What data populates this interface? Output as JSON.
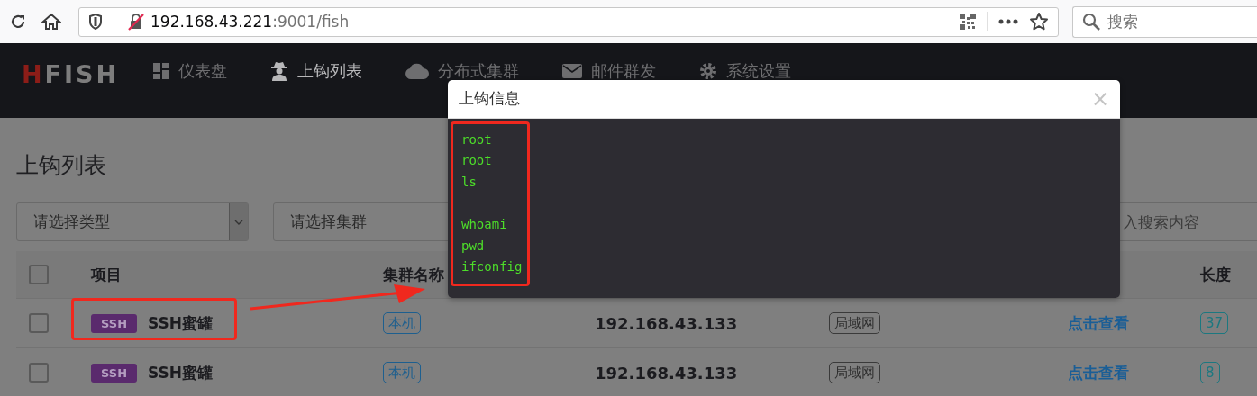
{
  "browser": {
    "url_host": "192.168.43.221",
    "url_rest": ":9001/fish",
    "search_placeholder": "搜索"
  },
  "nav": {
    "logo": "HFISH",
    "items": [
      {
        "label": "仪表盘",
        "selected": false
      },
      {
        "label": "上钩列表",
        "selected": true
      },
      {
        "label": "分布式集群",
        "selected": false
      },
      {
        "label": "邮件群发",
        "selected": false
      },
      {
        "label": "系统设置",
        "selected": false
      }
    ]
  },
  "page_title": "上钩列表",
  "filters": {
    "type_select": "请选择类型",
    "cluster_select": "请选择集群",
    "search_placeholder": "入搜索内容"
  },
  "table": {
    "select_all": {
      "checked": false
    },
    "columns": [
      "项目",
      "集群名称",
      "长度"
    ],
    "rows": [
      {
        "checked": false,
        "tag": "SSH",
        "project": "SSH蜜罐",
        "cluster": "本机",
        "ip": "192.168.43.133",
        "network": "局域网",
        "detail": "点击查看",
        "length": "37"
      },
      {
        "checked": false,
        "tag": "SSH",
        "project": "SSH蜜罐",
        "cluster": "本机",
        "ip": "192.168.43.133",
        "network": "局域网",
        "detail": "点击查看",
        "length": "8"
      }
    ]
  },
  "modal": {
    "title": "上钩信息",
    "close": "×",
    "content": "root\nroot\nls\n\nwhoami\npwd\nifconfig"
  }
}
